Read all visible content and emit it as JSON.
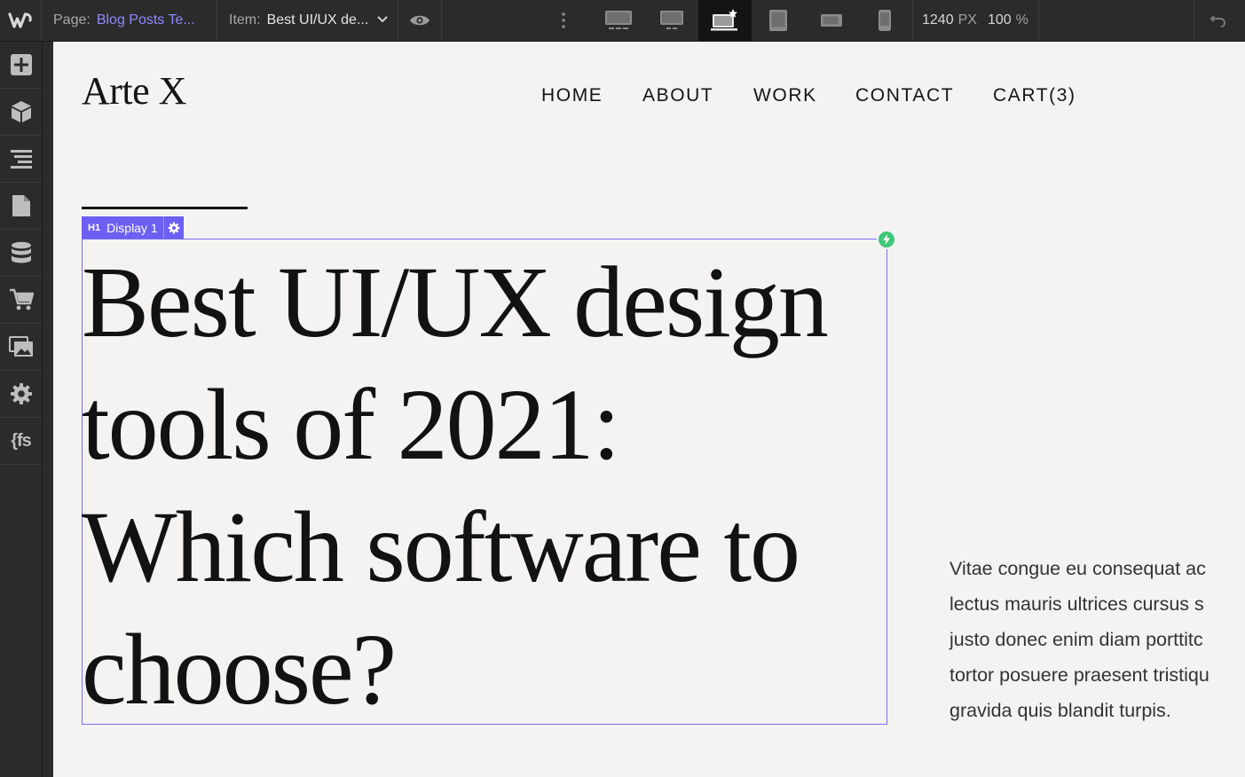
{
  "topbar": {
    "page_key": "Page:",
    "page_value": "Blog Posts Te...",
    "item_key": "Item:",
    "item_value": "Best UI/UX de...",
    "width_value": "1240",
    "width_unit": "PX",
    "zoom_value": "100",
    "zoom_unit": "%",
    "breakpoints": [
      "desktop-xxl",
      "desktop-xl",
      "desktop-base",
      "tablet",
      "mobile-landscape",
      "mobile-portrait"
    ],
    "active_breakpoint": "desktop-base"
  },
  "leftbar": {
    "items": [
      "add",
      "components",
      "navigator",
      "pages",
      "cms",
      "ecommerce",
      "assets",
      "settings",
      "finsweet"
    ],
    "finsweet_label": "{fs"
  },
  "site": {
    "brand": "Arte X",
    "nav": [
      "HOME",
      "ABOUT",
      "WORK",
      "CONTACT",
      "CART(3)"
    ],
    "selection": {
      "tag": "H1",
      "class_name": "Display 1"
    },
    "headline_lines": [
      "Best UI/UX design",
      "tools of 2021:",
      "Which software to",
      "choose?"
    ],
    "body_lines": [
      "Vitae congue eu consequat ac",
      "lectus mauris ultrices cursus s",
      "justo donec enim diam porttitc",
      "tortor posuere praesent tristiqu",
      "gravida quis blandit turpis."
    ]
  },
  "colors": {
    "ui_bg": "#2b2b2b",
    "canvas_bg": "#f4f3f2",
    "accent_purple": "#6d5ff2",
    "page_link": "#8b8bff",
    "bolt_green": "#3ec77a"
  }
}
